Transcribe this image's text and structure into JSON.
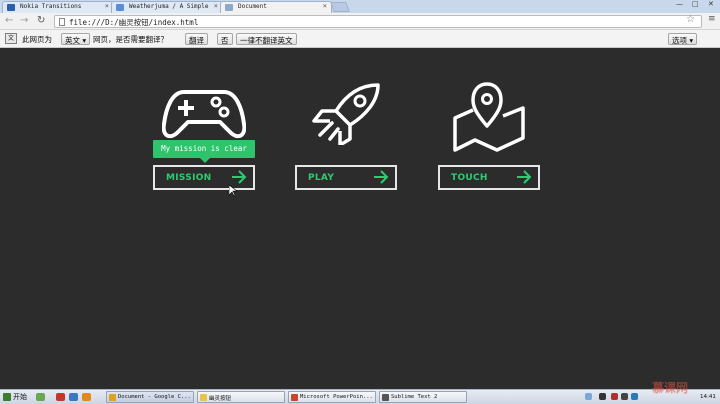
{
  "browser": {
    "tabs": [
      {
        "title": "Nokia Transitions",
        "fav_color": "#2b5fa8"
      },
      {
        "title": "Weatherjuma / A Simple",
        "fav_color": "#5a8fd6"
      },
      {
        "title": "Document",
        "fav_color": "#8fa9c8"
      }
    ],
    "url": "file:///D:/幽灵按钮/index.html"
  },
  "translate_bar": {
    "prefix": "此网页为",
    "language": "英文",
    "question": "网页，是否需要翻译？",
    "translate_button": "翻译",
    "no_button": "否",
    "never_button": "一律不翻译英文",
    "options_button": "选项"
  },
  "content": {
    "tooltip": "My mission is clear",
    "buttons": [
      {
        "label": "MISSION",
        "icon": "gamepad-icon"
      },
      {
        "label": "PLAY",
        "icon": "rocket-icon"
      },
      {
        "label": "TOUCH",
        "icon": "map-pin-icon"
      }
    ],
    "accent_color": "#2ecc71",
    "background_color": "#2c2c2c"
  },
  "taskbar": {
    "start_label": "开始",
    "tasks": [
      {
        "label": "Document - Google C...",
        "icon_color": "#e0a21b"
      },
      {
        "label": "幽灵按钮",
        "icon_color": "#e8c24a"
      },
      {
        "label": "Microsoft PowerPoin...",
        "icon_color": "#c9452b"
      },
      {
        "label": "Sublime Text 2",
        "icon_color": "#555555"
      }
    ],
    "clock": "14:41",
    "watermark": "慕课网"
  }
}
